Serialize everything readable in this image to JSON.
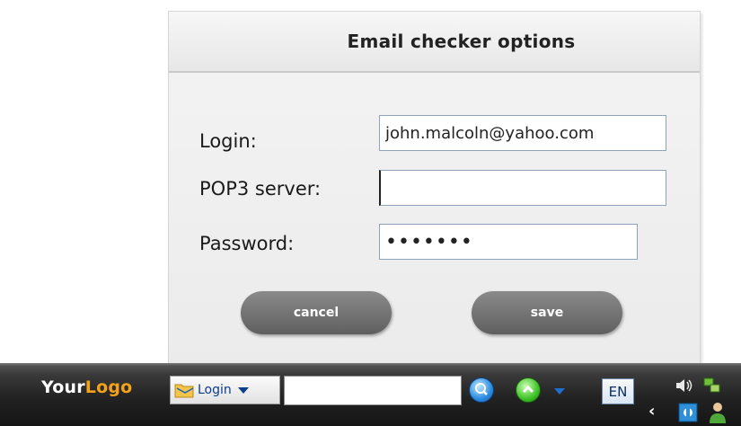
{
  "dialog": {
    "title": "Email checker options",
    "fields": [
      {
        "label": "Login:",
        "value": "john.malcoln@yahoo.com"
      },
      {
        "label": "POP3 server:",
        "value": ""
      },
      {
        "label": "Password:",
        "value": "•••••••"
      }
    ],
    "buttons": {
      "cancel_label": "cancel",
      "save_label": "save"
    }
  },
  "taskbar": {
    "logo": {
      "part1": "Your",
      "part2": "Logo"
    },
    "login_dropdown_label": "Login",
    "search_value": "",
    "language": "EN"
  },
  "colors": {
    "logo_accent": "#f5a21b",
    "button": "#6e6e6e",
    "input_border": "#8fa3bd"
  },
  "icons": [
    "folder-icon",
    "chevron-down-icon",
    "search-icon",
    "go-up-icon",
    "speaker-icon",
    "network-icon",
    "show-hidden-icons-chevron",
    "app-icon",
    "user-icon"
  ]
}
